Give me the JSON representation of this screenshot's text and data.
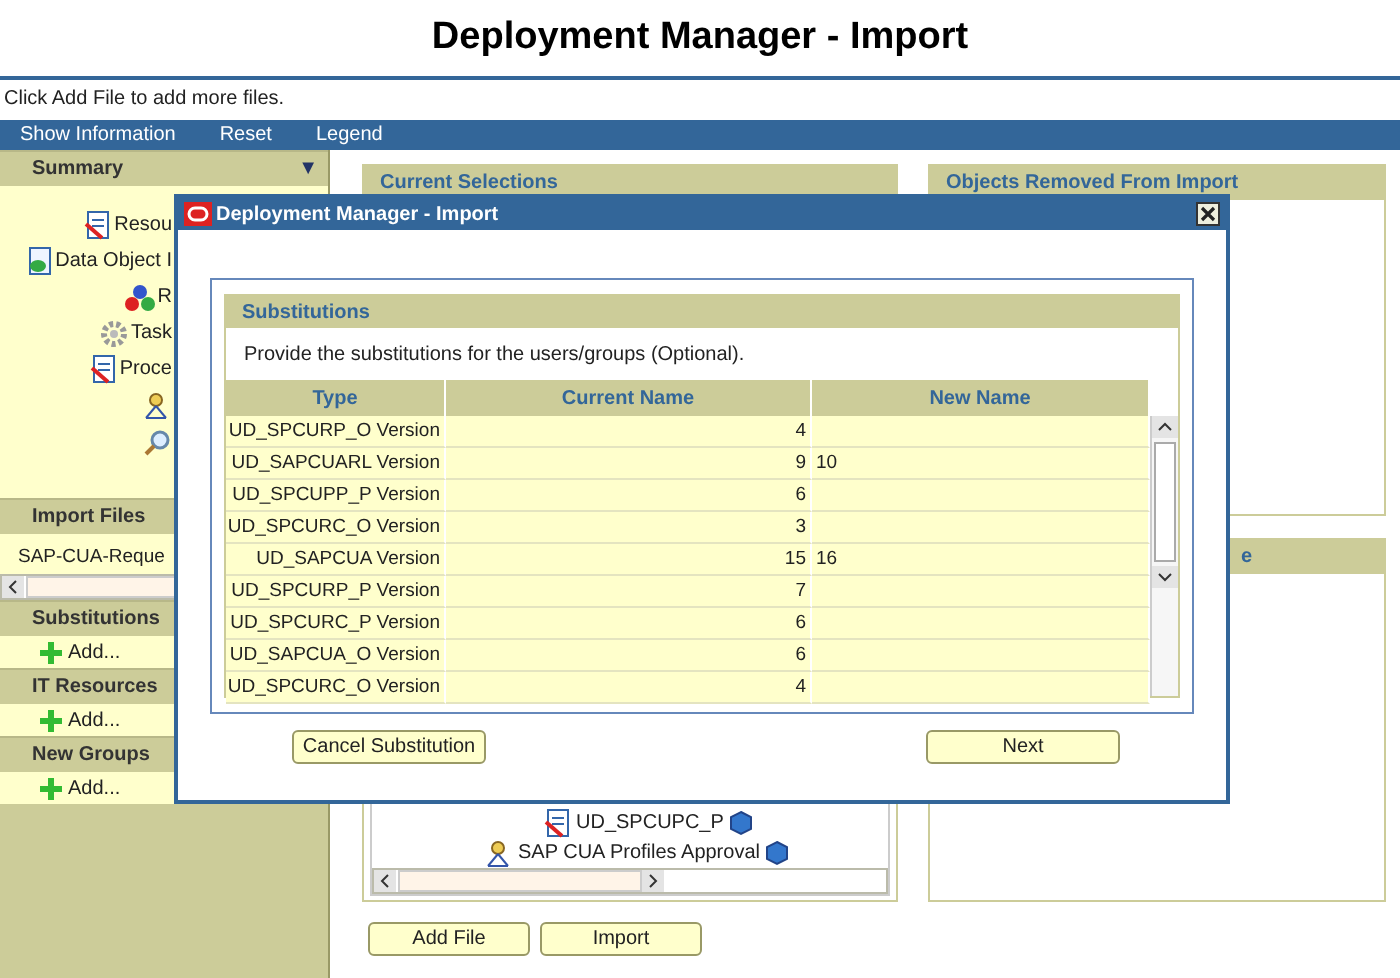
{
  "page_title": "Deployment Manager - Import",
  "instruction": "Click Add File to add more files.",
  "menu": [
    "Show Information",
    "Reset",
    "Legend"
  ],
  "sidebar": {
    "summary": {
      "title": "Summary",
      "toggle": "▼",
      "items": [
        {
          "kind": "document",
          "label": "Resou"
        },
        {
          "kind": "data",
          "label": "Data Object I"
        },
        {
          "kind": "roles",
          "label": "R"
        },
        {
          "kind": "task",
          "label": "Task"
        },
        {
          "kind": "process",
          "label": "Proce"
        },
        {
          "kind": "workflow"
        },
        {
          "kind": "search"
        }
      ]
    },
    "import_files": {
      "title": "Import Files",
      "files": [
        "SAP-CUA-Reque"
      ]
    },
    "sections": [
      {
        "title": "Substitutions",
        "action": "Add..."
      },
      {
        "title": "IT Resources",
        "action": "Add..."
      },
      {
        "title": "New Groups",
        "action": "Add..."
      }
    ]
  },
  "current_selections": {
    "title": "Current Selections",
    "items": [
      {
        "kind": "document",
        "label": "UD_SPCUPC_P"
      },
      {
        "kind": "workflow",
        "label": "SAP CUA Profiles Approval"
      }
    ]
  },
  "objects_removed": {
    "title": "Objects Removed From Import"
  },
  "lower_panel": {
    "title": "e"
  },
  "buttons": [
    "Add File",
    "Import"
  ],
  "dialog": {
    "title": "Deployment Manager - Import",
    "section_title": "Substitutions",
    "description": "Provide the substitutions for the users/groups (Optional).",
    "columns": [
      "Type",
      "Current Name",
      "New Name"
    ],
    "rows": [
      {
        "type": "UD_SPCURP_O Version",
        "current": "4",
        "new": ""
      },
      {
        "type": "UD_SAPCUARL Version",
        "current": "9",
        "new": "10"
      },
      {
        "type": "UD_SPCUPP_P Version",
        "current": "6",
        "new": ""
      },
      {
        "type": "UD_SPCURC_O Version",
        "current": "3",
        "new": ""
      },
      {
        "type": "UD_SAPCUA Version",
        "current": "15",
        "new": "16"
      },
      {
        "type": "UD_SPCURP_P Version",
        "current": "7",
        "new": ""
      },
      {
        "type": "UD_SPCURC_P Version",
        "current": "6",
        "new": ""
      },
      {
        "type": "UD_SAPCUA_O Version",
        "current": "6",
        "new": ""
      },
      {
        "type": "UD_SPCURC_O Version",
        "current": "4",
        "new": ""
      }
    ],
    "buttons": [
      "Cancel Substitution",
      "Next"
    ]
  }
}
